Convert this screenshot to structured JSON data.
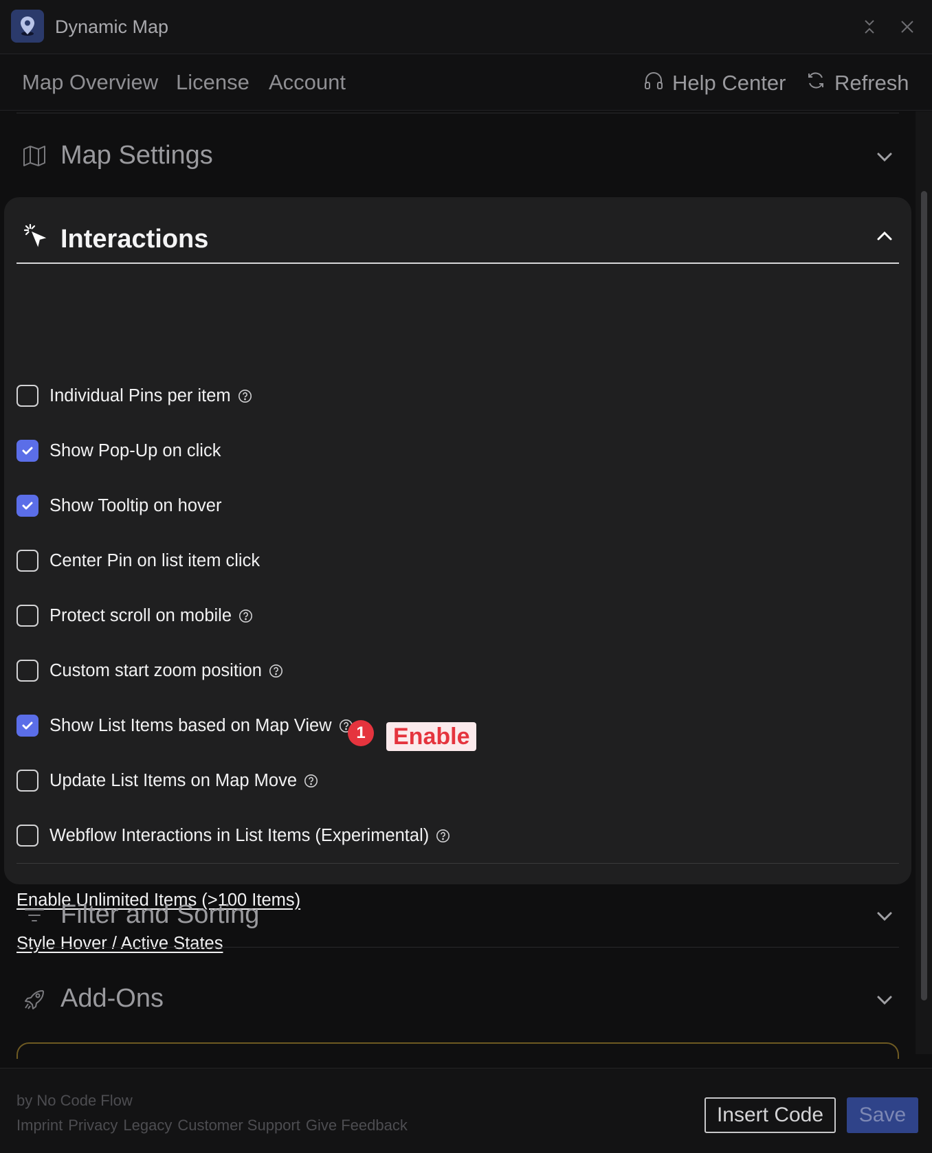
{
  "window": {
    "title": "Dynamic Map",
    "app_icon": "map-pin-icon"
  },
  "nav": {
    "items": [
      "Map Overview",
      "License",
      "Account"
    ],
    "help_label": "Help Center",
    "refresh_label": "Refresh"
  },
  "sections": {
    "map_settings": {
      "label": "Map Settings",
      "icon": "map-icon",
      "expanded": false
    },
    "interactions": {
      "label": "Interactions",
      "icon": "cursor-click-icon",
      "expanded": true,
      "options": [
        {
          "label": "Individual Pins per item",
          "checked": false,
          "help": true
        },
        {
          "label": "Show Pop-Up on click",
          "checked": true,
          "help": false
        },
        {
          "label": "Show Tooltip on hover",
          "checked": true,
          "help": false
        },
        {
          "label": "Center Pin on list item click",
          "checked": false,
          "help": false
        },
        {
          "label": "Protect scroll on mobile",
          "checked": false,
          "help": true
        },
        {
          "label": "Custom start zoom position",
          "checked": false,
          "help": true
        },
        {
          "label": "Show List Items based on Map View",
          "checked": true,
          "help": true
        },
        {
          "label": "Update List Items on Map Move",
          "checked": false,
          "help": true
        },
        {
          "label": "Webflow Interactions in List Items (Experimental)",
          "checked": false,
          "help": true
        }
      ],
      "links": [
        "Enable Unlimited Items (>100 Items)",
        "Style Hover / Active States"
      ]
    },
    "filter_sorting": {
      "label": "Filter and Sorting",
      "icon": "filter-icon",
      "expanded": false
    },
    "addons": {
      "label": "Add-Ons",
      "icon": "rocket-icon",
      "expanded": false
    }
  },
  "annotation": {
    "number": "1",
    "text": "Enable"
  },
  "footer": {
    "by": "by No Code Flow",
    "links": [
      "Imprint",
      "Privacy",
      "Legacy",
      "Customer Support",
      "Give Feedback"
    ],
    "insert_label": "Insert Code",
    "save_label": "Save"
  },
  "colors": {
    "accent": "#5b6ee8",
    "annotation_red": "#e5343e",
    "save_button": "#2f4389"
  }
}
